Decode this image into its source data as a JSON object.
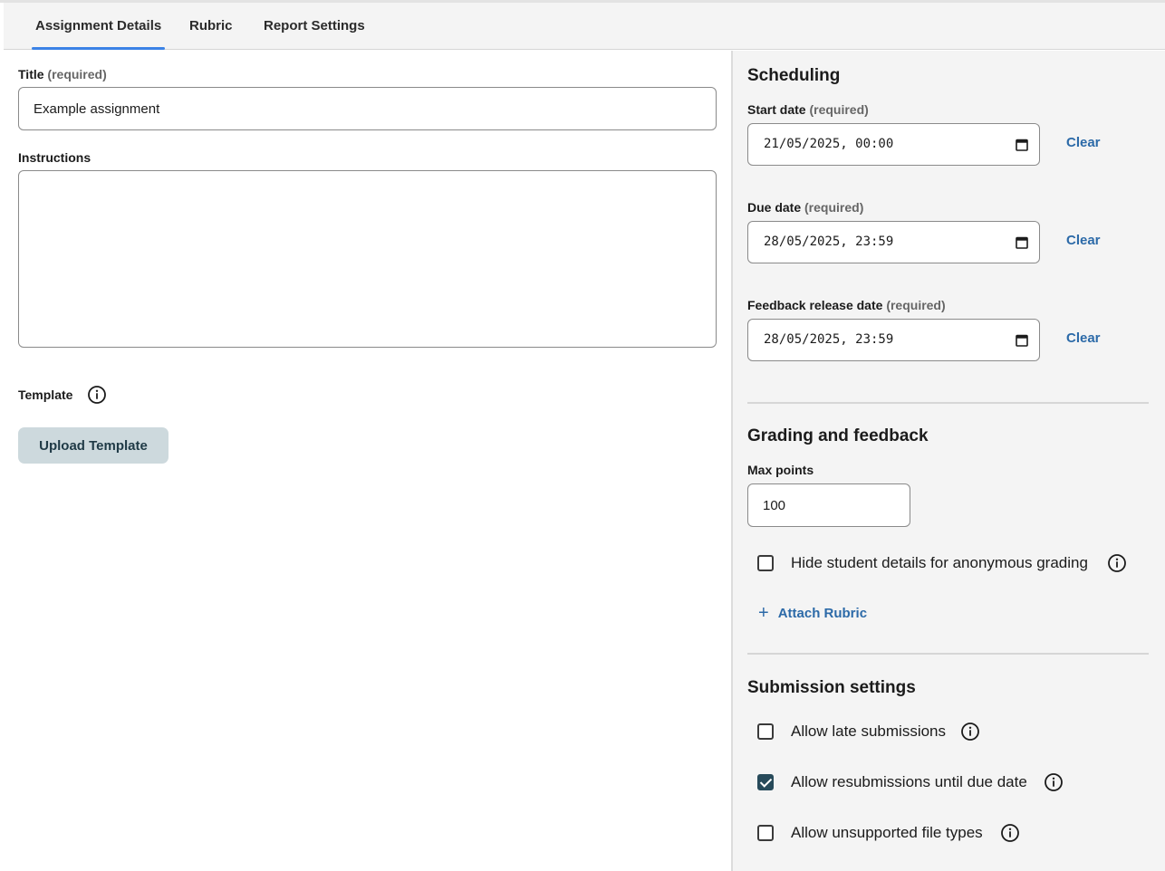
{
  "tabs": [
    {
      "label": "Assignment Details",
      "active": true
    },
    {
      "label": "Rubric",
      "active": false
    },
    {
      "label": "Report Settings",
      "active": false
    }
  ],
  "details": {
    "title_label": "Title",
    "title_req": "(required)",
    "title_value": "Example assignment",
    "instructions_label": "Instructions",
    "instructions_value": "",
    "template_label": "Template",
    "upload_button": "Upload Template"
  },
  "scheduling": {
    "heading": "Scheduling",
    "start_label": "Start date",
    "start_req": "(required)",
    "start_value": "21/05/2025, 00:00",
    "due_label": "Due date",
    "due_req": "(required)",
    "due_value": "28/05/2025, 23:59",
    "feedback_label": "Feedback release date",
    "feedback_req": "(required)",
    "feedback_value": "28/05/2025, 23:59",
    "clear": "Clear"
  },
  "grading": {
    "heading": "Grading and feedback",
    "max_points_label": "Max points",
    "max_points_value": "100",
    "anonymous_label": "Hide student details for anonymous grading",
    "anonymous_checked": false,
    "attach_rubric": "Attach Rubric"
  },
  "submission": {
    "heading": "Submission settings",
    "late_label": "Allow late submissions",
    "late_checked": false,
    "resubmit_label": "Allow resubmissions until due date",
    "resubmit_checked": true,
    "unsupported_label": "Allow unsupported file types",
    "unsupported_checked": false
  },
  "colors": {
    "accent": "#3b82e6",
    "link": "#2c6aa8",
    "checkbox_checked": "#274a5a",
    "button_bg": "#cdd9dd"
  }
}
